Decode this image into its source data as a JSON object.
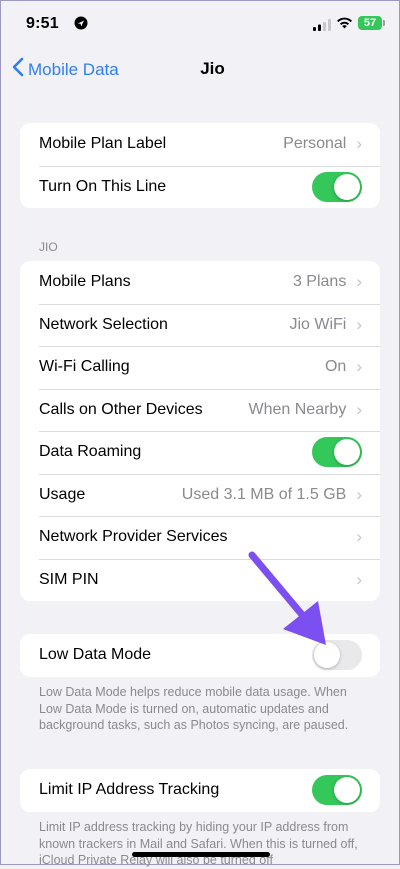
{
  "status": {
    "time": "9:51",
    "battery": "57"
  },
  "nav": {
    "back_label": "Mobile Data",
    "title": "Jio"
  },
  "group1": {
    "plan_label": "Mobile Plan Label",
    "plan_value": "Personal",
    "line_label": "Turn On This Line"
  },
  "section": {
    "header": "JIO"
  },
  "group2": {
    "rows": [
      {
        "label": "Mobile Plans",
        "value": "3 Plans"
      },
      {
        "label": "Network Selection",
        "value": "Jio WiFi"
      },
      {
        "label": "Wi-Fi Calling",
        "value": "On"
      },
      {
        "label": "Calls on Other Devices",
        "value": "When Nearby"
      },
      {
        "label": "Data Roaming"
      },
      {
        "label": "Usage",
        "value": "Used 3.1 MB of 1.5 GB"
      },
      {
        "label": "Network Provider Services"
      },
      {
        "label": "SIM PIN"
      }
    ]
  },
  "low_data": {
    "label": "Low Data Mode",
    "footnote": "Low Data Mode helps reduce mobile data usage. When Low Data Mode is turned on, automatic updates and background tasks, such as Photos syncing, are paused."
  },
  "limit_ip": {
    "label": "Limit IP Address Tracking",
    "footnote": "Limit IP address tracking by hiding your IP address from known trackers in Mail and Safari. When this is turned off, iCloud Private Relay will also be turned off"
  },
  "colors": {
    "accent": "#2f7ef5",
    "toggle_on": "#34c759",
    "arrow": "#7b4ff0"
  }
}
